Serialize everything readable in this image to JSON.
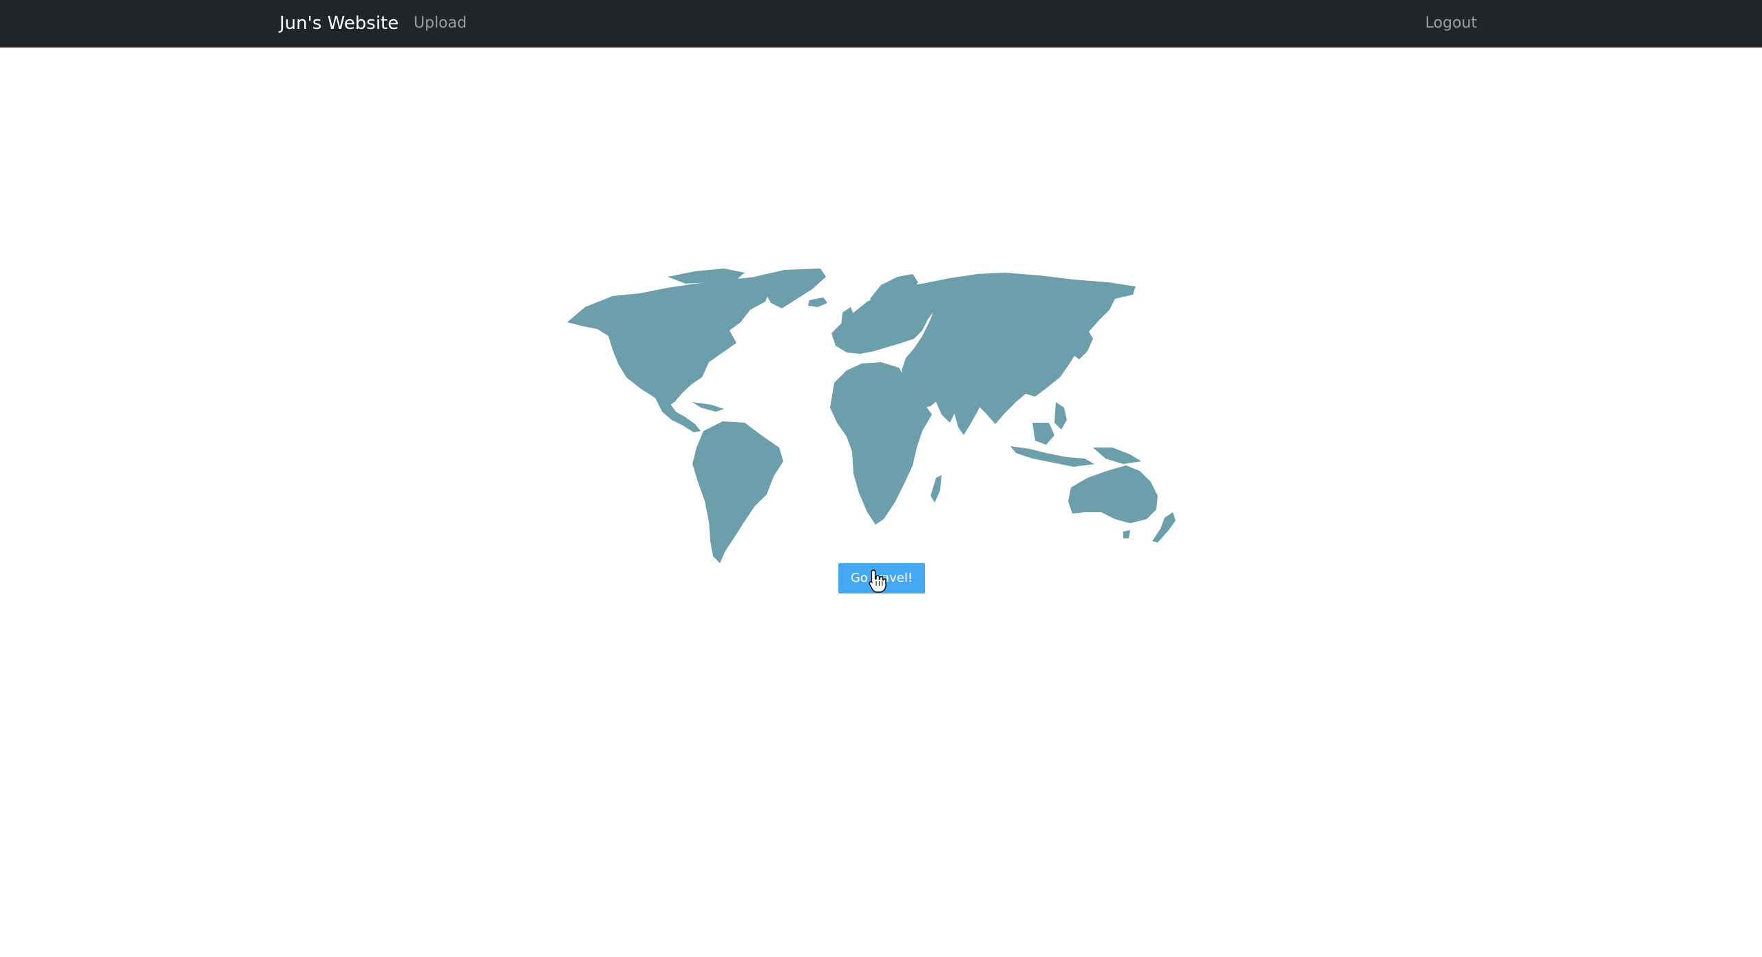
{
  "navbar": {
    "brand": "Jun's Website",
    "upload_label": "Upload",
    "logout_label": "Logout",
    "background_color": "#212529"
  },
  "main": {
    "map_icon": "world-map-icon",
    "map_color": "#6d9eab",
    "travel_button_label": "Go travel!",
    "travel_button_color": "#45a8f5"
  },
  "cursor": {
    "icon": "hand-pointer-icon"
  }
}
